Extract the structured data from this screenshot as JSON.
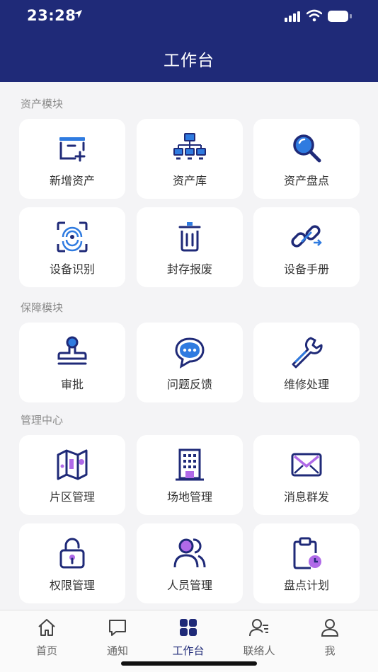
{
  "status": {
    "time": "23:28"
  },
  "header": {
    "title": "工作台"
  },
  "sections": [
    {
      "title": "资产模块",
      "items": [
        {
          "label": "新增资产",
          "icon": "add-asset-icon"
        },
        {
          "label": "资产库",
          "icon": "asset-network-icon"
        },
        {
          "label": "资产盘点",
          "icon": "magnifier-icon"
        },
        {
          "label": "设备识别",
          "icon": "scan-icon"
        },
        {
          "label": "封存报废",
          "icon": "trash-icon"
        },
        {
          "label": "设备手册",
          "icon": "link-icon"
        }
      ]
    },
    {
      "title": "保障模块",
      "items": [
        {
          "label": "审批",
          "icon": "stamp-icon"
        },
        {
          "label": "问题反馈",
          "icon": "chat-bubble-icon"
        },
        {
          "label": "维修处理",
          "icon": "wrench-icon"
        }
      ]
    },
    {
      "title": "管理中心",
      "items": [
        {
          "label": "片区管理",
          "icon": "map-icon"
        },
        {
          "label": "场地管理",
          "icon": "building-icon"
        },
        {
          "label": "消息群发",
          "icon": "envelope-icon"
        },
        {
          "label": "权限管理",
          "icon": "lock-icon"
        },
        {
          "label": "人员管理",
          "icon": "users-icon"
        },
        {
          "label": "盘点计划",
          "icon": "clipboard-clock-icon"
        }
      ]
    }
  ],
  "tabs": [
    {
      "label": "首页",
      "icon": "home-icon"
    },
    {
      "label": "通知",
      "icon": "message-icon"
    },
    {
      "label": "工作台",
      "icon": "grid-icon",
      "active": true
    },
    {
      "label": "联络人",
      "icon": "contacts-icon"
    },
    {
      "label": "我",
      "icon": "person-icon"
    }
  ],
  "colors": {
    "primary": "#1f2a78",
    "accent_blue": "#2f7be0",
    "accent_purple": "#b06ae8",
    "background": "#f4f4f6"
  }
}
